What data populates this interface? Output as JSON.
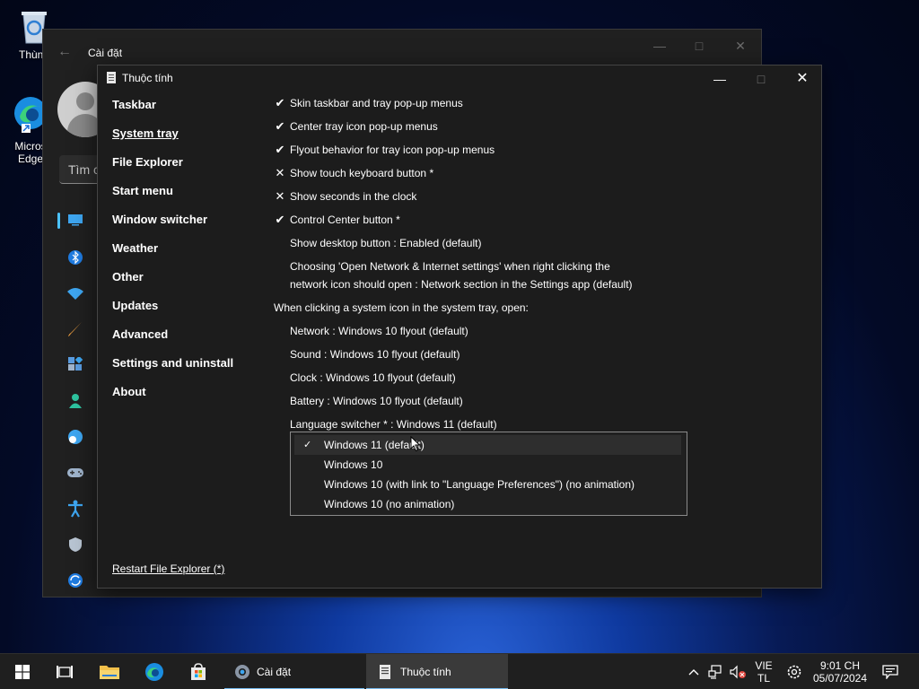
{
  "desktop": {
    "recycle_bin_label": "Thùng",
    "edge_label_line1": "Micros",
    "edge_label_line2": "Edge"
  },
  "settings_window": {
    "title": "Cài đặt",
    "search_placeholder": "Tìm c",
    "nav_icons": [
      "system-icon",
      "bluetooth-icon",
      "network-icon",
      "personalization-icon",
      "apps-icon",
      "accounts-icon",
      "time-language-icon",
      "gaming-icon",
      "accessibility-icon",
      "privacy-icon",
      "windows-update-icon"
    ]
  },
  "props_window": {
    "title": "Thuộc tính",
    "sidebar": [
      {
        "label": "Taskbar"
      },
      {
        "label": "System tray",
        "active": true
      },
      {
        "label": "File Explorer"
      },
      {
        "label": "Start menu"
      },
      {
        "label": "Window switcher"
      },
      {
        "label": "Weather"
      },
      {
        "label": "Other"
      },
      {
        "label": "Updates"
      },
      {
        "label": "Advanced"
      },
      {
        "label": "Settings and uninstall"
      },
      {
        "label": "About"
      }
    ],
    "options": [
      {
        "mark": "✔",
        "label": "Skin taskbar and tray pop-up menus"
      },
      {
        "mark": "✔",
        "label": "Center tray icon pop-up menus"
      },
      {
        "mark": "✔",
        "label": "Flyout behavior for tray icon pop-up menus"
      },
      {
        "mark": "✕",
        "label": "Show touch keyboard button *"
      },
      {
        "mark": "✕",
        "label": "Show seconds in the clock"
      },
      {
        "mark": "✔",
        "label": "Control Center button *"
      },
      {
        "mark": "",
        "label": "Show desktop button : Enabled (default)"
      },
      {
        "mark": "",
        "label": "Choosing 'Open Network & Internet settings' when right clicking the",
        "label2": "network icon should open : Network section in the Settings app (default)"
      }
    ],
    "section_heading": "When clicking a system icon in the system tray, open:",
    "flyouts": [
      "Network : Windows 10 flyout (default)",
      "Sound : Windows 10 flyout (default)",
      "Clock : Windows 10 flyout (default)",
      "Battery : Windows 10 flyout (default)",
      "Language switcher * : Windows 11 (default)"
    ],
    "dropdown": {
      "options": [
        {
          "label": "Windows 11 (default)",
          "selected": true
        },
        {
          "label": "Windows 10"
        },
        {
          "label": "Windows 10 (with link to \"Language Preferences\") (no animation)"
        },
        {
          "label": "Windows 10 (no animation)"
        }
      ],
      "check_mark": "✓"
    },
    "restart_link": "Restart File Explorer (*)"
  },
  "taskbar": {
    "apps": [
      {
        "label": "Cài đặt",
        "icon": "gear-icon",
        "active": false
      },
      {
        "label": "Thuộc tính",
        "icon": "properties-icon",
        "active": true
      }
    ],
    "lang_line1": "VIE",
    "lang_line2": "TL",
    "time": "9:01 CH",
    "date": "05/07/2024"
  }
}
